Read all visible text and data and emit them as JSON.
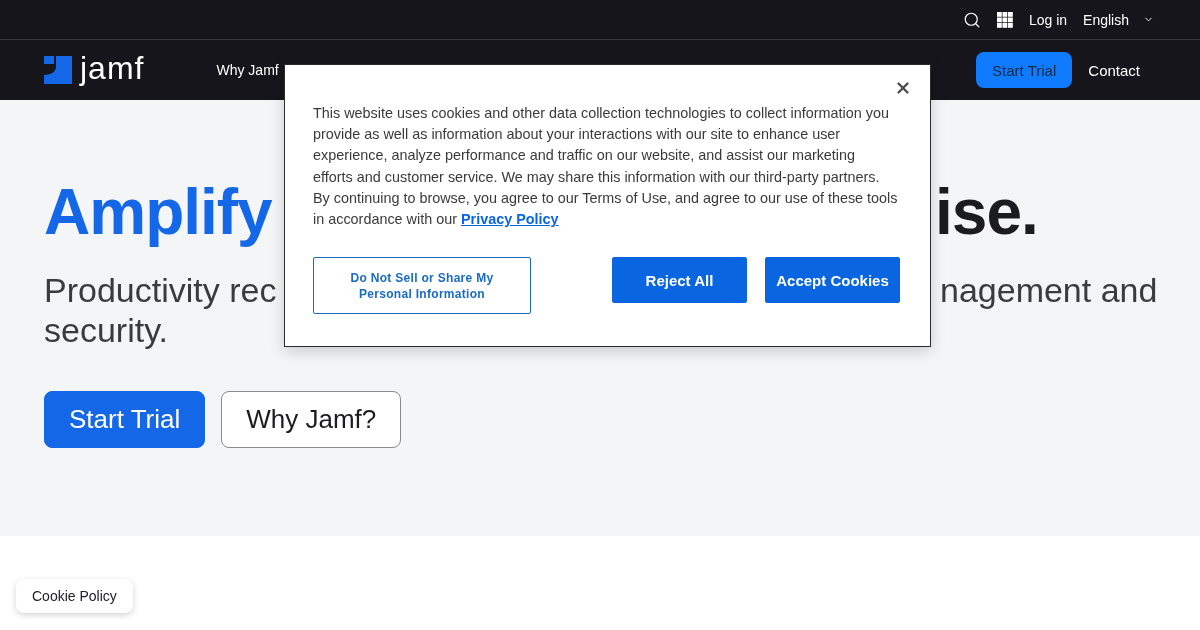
{
  "top_bar": {
    "login": "Log in",
    "language": "English"
  },
  "nav": {
    "logo": "jamf",
    "items": [
      "Why Jamf"
    ],
    "buttons": [
      {
        "label": "Start Trial",
        "kind": "primary"
      },
      {
        "label": "Contact",
        "kind": "link"
      }
    ]
  },
  "hero": {
    "heading": {
      "left": "Amplify",
      "right": "ise."
    },
    "subtitle": {
      "line_1_left": "Productivity rec",
      "line_1_right": "nagement and",
      "line_2": "security."
    },
    "buttons": [
      {
        "label": "Start Trial",
        "kind": "primary"
      },
      {
        "label": "Why Jamf?",
        "kind": "secondary"
      }
    ]
  },
  "cookie_dialog": {
    "text": "This website uses cookies and other data collection technologies to collect information you provide as well as information about your interactions with our site to enhance user experience, analyze performance and traffic on our website, and assist our marketing efforts and customer service. We may share this information with our third-party partners. By continuing to browse, you agree to our Terms of Use, and agree to our use of these tools in accordance with our",
    "link": "Privacy Policy",
    "buttons": [
      {
        "label": "Do Not Sell or Share My Personal Information",
        "kind": "outline"
      },
      {
        "label": "Reject All",
        "kind": "primary"
      },
      {
        "label": "Accept Cookies",
        "kind": "primary"
      }
    ]
  },
  "cookie_policy_tab": "Cookie Policy"
}
